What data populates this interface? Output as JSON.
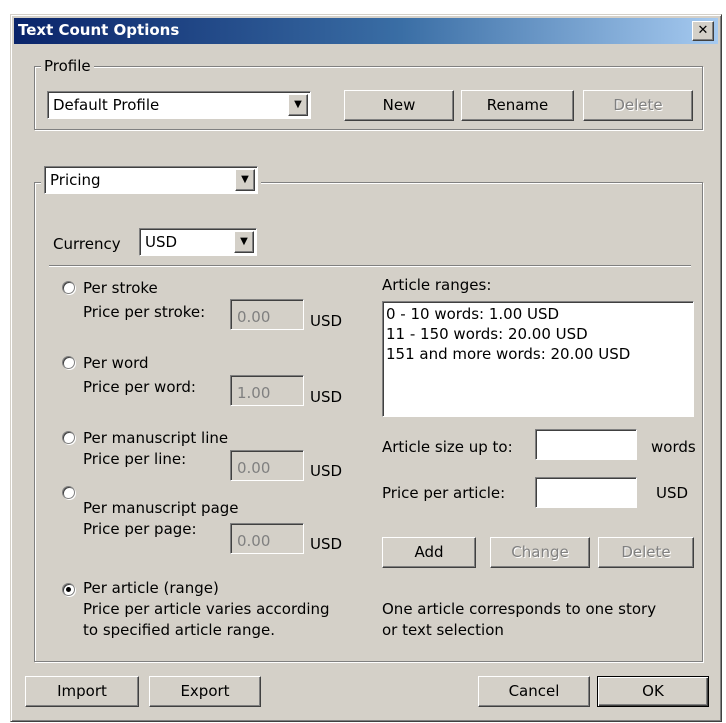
{
  "window": {
    "title": "Text Count Options",
    "close_icon": "close-icon"
  },
  "profile": {
    "legend": "Profile",
    "selected": "Default Profile",
    "new_label": "New",
    "rename_label": "Rename",
    "delete_label": "Delete"
  },
  "section": {
    "selected": "Pricing"
  },
  "currency": {
    "label": "Currency",
    "selected": "USD"
  },
  "options": {
    "stroke": {
      "label": "Per stroke",
      "price_label": "Price per stroke:",
      "value": "0.00",
      "unit": "USD",
      "checked": false
    },
    "word": {
      "label": "Per word",
      "price_label": "Price per word:",
      "value": "1.00",
      "unit": "USD",
      "checked": false
    },
    "line": {
      "label": "Per manuscript line",
      "price_label": "Price per line:",
      "value": "0.00",
      "unit": "USD",
      "checked": false
    },
    "page": {
      "label": "Per manuscript page",
      "price_label": "Price per page:",
      "value": "0.00",
      "unit": "USD",
      "checked": false
    },
    "article": {
      "label": "Per article (range)",
      "desc1": "Price per article varies according",
      "desc2": "to specified article range.",
      "checked": true
    }
  },
  "ranges": {
    "label": "Article ranges:",
    "items": [
      "0 - 10 words: 1.00 USD",
      "11 - 150 words: 20.00 USD",
      "151 and more words: 20.00 USD"
    ],
    "size_label": "Article size up to:",
    "size_value": "",
    "size_unit": "words",
    "price_label": "Price per article:",
    "price_value": "",
    "price_unit": "USD",
    "add_label": "Add",
    "change_label": "Change",
    "delete_label": "Delete",
    "note1": "One article corresponds to one story",
    "note2": "or text selection"
  },
  "footer": {
    "import_label": "Import",
    "export_label": "Export",
    "cancel_label": "Cancel",
    "ok_label": "OK"
  }
}
